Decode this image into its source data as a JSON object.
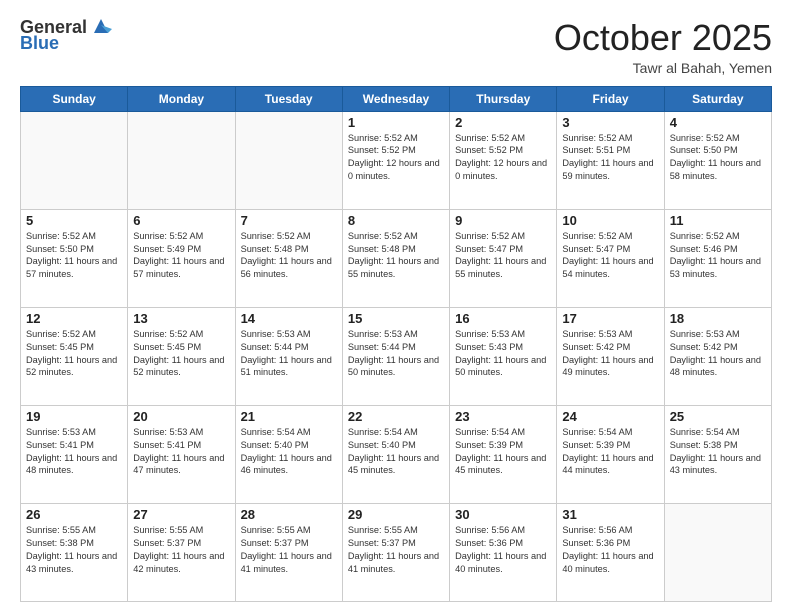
{
  "header": {
    "logo_line1": "General",
    "logo_line2": "Blue",
    "month": "October 2025",
    "location": "Tawr al Bahah, Yemen"
  },
  "weekdays": [
    "Sunday",
    "Monday",
    "Tuesday",
    "Wednesday",
    "Thursday",
    "Friday",
    "Saturday"
  ],
  "weeks": [
    [
      {
        "day": "",
        "sunrise": "",
        "sunset": "",
        "daylight": ""
      },
      {
        "day": "",
        "sunrise": "",
        "sunset": "",
        "daylight": ""
      },
      {
        "day": "",
        "sunrise": "",
        "sunset": "",
        "daylight": ""
      },
      {
        "day": "1",
        "sunrise": "Sunrise: 5:52 AM",
        "sunset": "Sunset: 5:52 PM",
        "daylight": "Daylight: 12 hours and 0 minutes."
      },
      {
        "day": "2",
        "sunrise": "Sunrise: 5:52 AM",
        "sunset": "Sunset: 5:52 PM",
        "daylight": "Daylight: 12 hours and 0 minutes."
      },
      {
        "day": "3",
        "sunrise": "Sunrise: 5:52 AM",
        "sunset": "Sunset: 5:51 PM",
        "daylight": "Daylight: 11 hours and 59 minutes."
      },
      {
        "day": "4",
        "sunrise": "Sunrise: 5:52 AM",
        "sunset": "Sunset: 5:50 PM",
        "daylight": "Daylight: 11 hours and 58 minutes."
      }
    ],
    [
      {
        "day": "5",
        "sunrise": "Sunrise: 5:52 AM",
        "sunset": "Sunset: 5:50 PM",
        "daylight": "Daylight: 11 hours and 57 minutes."
      },
      {
        "day": "6",
        "sunrise": "Sunrise: 5:52 AM",
        "sunset": "Sunset: 5:49 PM",
        "daylight": "Daylight: 11 hours and 57 minutes."
      },
      {
        "day": "7",
        "sunrise": "Sunrise: 5:52 AM",
        "sunset": "Sunset: 5:48 PM",
        "daylight": "Daylight: 11 hours and 56 minutes."
      },
      {
        "day": "8",
        "sunrise": "Sunrise: 5:52 AM",
        "sunset": "Sunset: 5:48 PM",
        "daylight": "Daylight: 11 hours and 55 minutes."
      },
      {
        "day": "9",
        "sunrise": "Sunrise: 5:52 AM",
        "sunset": "Sunset: 5:47 PM",
        "daylight": "Daylight: 11 hours and 55 minutes."
      },
      {
        "day": "10",
        "sunrise": "Sunrise: 5:52 AM",
        "sunset": "Sunset: 5:47 PM",
        "daylight": "Daylight: 11 hours and 54 minutes."
      },
      {
        "day": "11",
        "sunrise": "Sunrise: 5:52 AM",
        "sunset": "Sunset: 5:46 PM",
        "daylight": "Daylight: 11 hours and 53 minutes."
      }
    ],
    [
      {
        "day": "12",
        "sunrise": "Sunrise: 5:52 AM",
        "sunset": "Sunset: 5:45 PM",
        "daylight": "Daylight: 11 hours and 52 minutes."
      },
      {
        "day": "13",
        "sunrise": "Sunrise: 5:52 AM",
        "sunset": "Sunset: 5:45 PM",
        "daylight": "Daylight: 11 hours and 52 minutes."
      },
      {
        "day": "14",
        "sunrise": "Sunrise: 5:53 AM",
        "sunset": "Sunset: 5:44 PM",
        "daylight": "Daylight: 11 hours and 51 minutes."
      },
      {
        "day": "15",
        "sunrise": "Sunrise: 5:53 AM",
        "sunset": "Sunset: 5:44 PM",
        "daylight": "Daylight: 11 hours and 50 minutes."
      },
      {
        "day": "16",
        "sunrise": "Sunrise: 5:53 AM",
        "sunset": "Sunset: 5:43 PM",
        "daylight": "Daylight: 11 hours and 50 minutes."
      },
      {
        "day": "17",
        "sunrise": "Sunrise: 5:53 AM",
        "sunset": "Sunset: 5:42 PM",
        "daylight": "Daylight: 11 hours and 49 minutes."
      },
      {
        "day": "18",
        "sunrise": "Sunrise: 5:53 AM",
        "sunset": "Sunset: 5:42 PM",
        "daylight": "Daylight: 11 hours and 48 minutes."
      }
    ],
    [
      {
        "day": "19",
        "sunrise": "Sunrise: 5:53 AM",
        "sunset": "Sunset: 5:41 PM",
        "daylight": "Daylight: 11 hours and 48 minutes."
      },
      {
        "day": "20",
        "sunrise": "Sunrise: 5:53 AM",
        "sunset": "Sunset: 5:41 PM",
        "daylight": "Daylight: 11 hours and 47 minutes."
      },
      {
        "day": "21",
        "sunrise": "Sunrise: 5:54 AM",
        "sunset": "Sunset: 5:40 PM",
        "daylight": "Daylight: 11 hours and 46 minutes."
      },
      {
        "day": "22",
        "sunrise": "Sunrise: 5:54 AM",
        "sunset": "Sunset: 5:40 PM",
        "daylight": "Daylight: 11 hours and 45 minutes."
      },
      {
        "day": "23",
        "sunrise": "Sunrise: 5:54 AM",
        "sunset": "Sunset: 5:39 PM",
        "daylight": "Daylight: 11 hours and 45 minutes."
      },
      {
        "day": "24",
        "sunrise": "Sunrise: 5:54 AM",
        "sunset": "Sunset: 5:39 PM",
        "daylight": "Daylight: 11 hours and 44 minutes."
      },
      {
        "day": "25",
        "sunrise": "Sunrise: 5:54 AM",
        "sunset": "Sunset: 5:38 PM",
        "daylight": "Daylight: 11 hours and 43 minutes."
      }
    ],
    [
      {
        "day": "26",
        "sunrise": "Sunrise: 5:55 AM",
        "sunset": "Sunset: 5:38 PM",
        "daylight": "Daylight: 11 hours and 43 minutes."
      },
      {
        "day": "27",
        "sunrise": "Sunrise: 5:55 AM",
        "sunset": "Sunset: 5:37 PM",
        "daylight": "Daylight: 11 hours and 42 minutes."
      },
      {
        "day": "28",
        "sunrise": "Sunrise: 5:55 AM",
        "sunset": "Sunset: 5:37 PM",
        "daylight": "Daylight: 11 hours and 41 minutes."
      },
      {
        "day": "29",
        "sunrise": "Sunrise: 5:55 AM",
        "sunset": "Sunset: 5:37 PM",
        "daylight": "Daylight: 11 hours and 41 minutes."
      },
      {
        "day": "30",
        "sunrise": "Sunrise: 5:56 AM",
        "sunset": "Sunset: 5:36 PM",
        "daylight": "Daylight: 11 hours and 40 minutes."
      },
      {
        "day": "31",
        "sunrise": "Sunrise: 5:56 AM",
        "sunset": "Sunset: 5:36 PM",
        "daylight": "Daylight: 11 hours and 40 minutes."
      },
      {
        "day": "",
        "sunrise": "",
        "sunset": "",
        "daylight": ""
      }
    ]
  ]
}
